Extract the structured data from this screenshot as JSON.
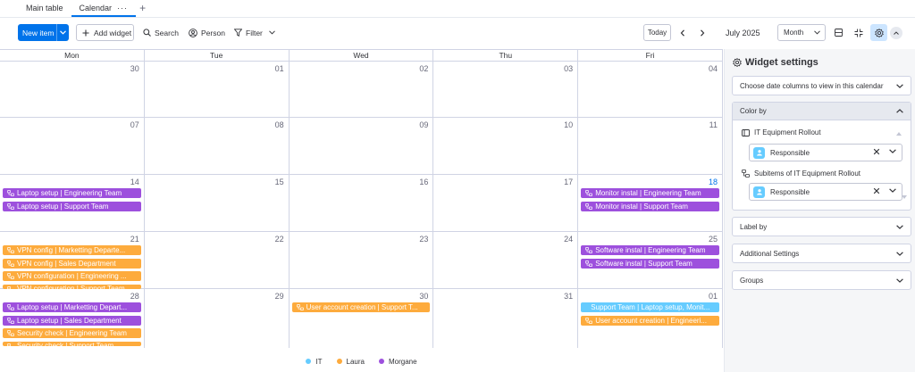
{
  "tabs": [
    {
      "label": "Main table",
      "active": false
    },
    {
      "label": "Calendar",
      "active": true,
      "menu": "···"
    }
  ],
  "tab_add": "+",
  "toolbar": {
    "new_item": "New item",
    "add_widget": "Add widget",
    "search": "Search",
    "person": "Person",
    "filter": "Filter",
    "today": "Today",
    "month_label": "July 2025",
    "view_select": "Month"
  },
  "calendar": {
    "days_of_week": [
      "Mon",
      "Tue",
      "Wed",
      "Thu",
      "Fri"
    ],
    "weeks": [
      {
        "days": [
          {
            "num": "30",
            "events": []
          },
          {
            "num": "01",
            "events": []
          },
          {
            "num": "02",
            "events": []
          },
          {
            "num": "03",
            "events": []
          },
          {
            "num": "04",
            "events": []
          }
        ]
      },
      {
        "days": [
          {
            "num": "07",
            "events": []
          },
          {
            "num": "08",
            "events": []
          },
          {
            "num": "09",
            "events": []
          },
          {
            "num": "10",
            "events": []
          },
          {
            "num": "11",
            "events": []
          }
        ]
      },
      {
        "days": [
          {
            "num": "14",
            "events": [
              {
                "text": "Laptop setup | Engineering Team",
                "color": "purple"
              },
              {
                "text": "Laptop setup | Support Team",
                "color": "purple"
              }
            ]
          },
          {
            "num": "15",
            "events": []
          },
          {
            "num": "16",
            "events": []
          },
          {
            "num": "17",
            "events": []
          },
          {
            "num": "18",
            "today": true,
            "events": [
              {
                "text": "Monitor instal | Engineering Team",
                "color": "purple"
              },
              {
                "text": "Monitor instal | Support Team",
                "color": "purple"
              }
            ]
          }
        ]
      },
      {
        "days": [
          {
            "num": "21",
            "events": [
              {
                "text": "VPN config | Marketting Departe...",
                "color": "orange"
              },
              {
                "text": "VPN config | Sales Department",
                "color": "orange"
              },
              {
                "text": "VPN configuration | Engineering ...",
                "color": "orange"
              },
              {
                "text": "VPN configuration | Support Team",
                "color": "orange",
                "clip": true
              }
            ]
          },
          {
            "num": "22",
            "events": []
          },
          {
            "num": "23",
            "events": []
          },
          {
            "num": "24",
            "events": []
          },
          {
            "num": "25",
            "events": [
              {
                "text": "Software instal | Engineering Team",
                "color": "purple"
              },
              {
                "text": "Software instal | Support Team",
                "color": "purple"
              }
            ]
          }
        ]
      },
      {
        "days": [
          {
            "num": "28",
            "events": [
              {
                "text": "Laptop setup | Marketting Depart...",
                "color": "purple"
              },
              {
                "text": "Laptop setup | Sales Department",
                "color": "purple"
              },
              {
                "text": "Security check | Engineering Team",
                "color": "orange"
              },
              {
                "text": "Security check | Support Team",
                "color": "orange",
                "clip": true
              }
            ]
          },
          {
            "num": "29",
            "events": []
          },
          {
            "num": "30",
            "events": [
              {
                "text": "User account creation | Support T...",
                "color": "orange"
              }
            ]
          },
          {
            "num": "31",
            "events": []
          },
          {
            "num": "01",
            "events": [
              {
                "text": "Support Team | Laptop setup, Monit...",
                "color": "blue",
                "noicon": true
              },
              {
                "text": "User account creation | Engineeri...",
                "color": "orange"
              }
            ]
          }
        ]
      }
    ]
  },
  "legend": [
    {
      "label": "IT",
      "color": "#66ccff"
    },
    {
      "label": "Laura",
      "color": "#fdab3d"
    },
    {
      "label": "Morgane",
      "color": "#9d50dd"
    }
  ],
  "colors": {
    "purple": "#9d50dd",
    "orange": "#fdab3d",
    "blue": "#66ccff",
    "primary": "#0073ea"
  },
  "panel": {
    "title": "Widget settings",
    "date_columns": "Choose date columns to view in this calendar",
    "color_by": "Color by",
    "board1": "IT Equipment Rollout",
    "board1_value": "Responsible",
    "board2": "Subitems of IT Equipment Rollout",
    "board2_value": "Responsible",
    "label_by": "Label by",
    "additional": "Additional Settings",
    "groups": "Groups"
  }
}
